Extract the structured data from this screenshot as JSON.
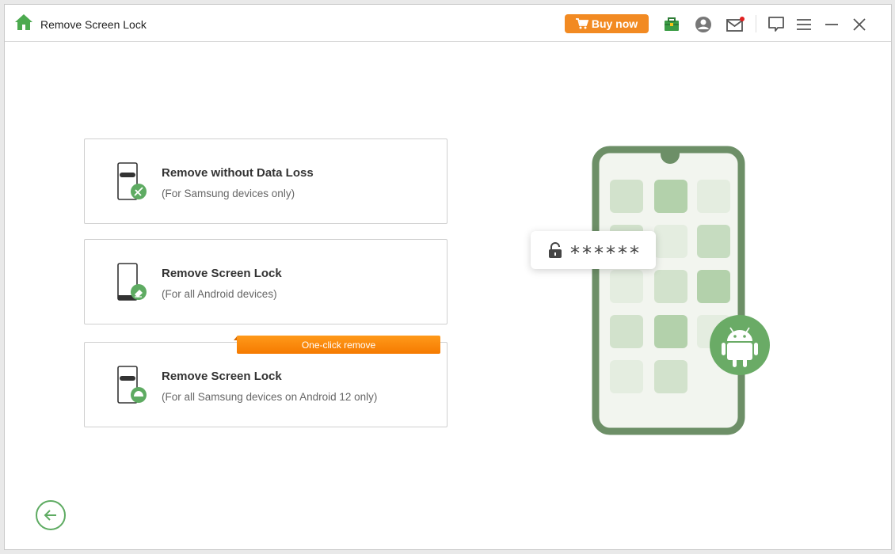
{
  "app": {
    "title": "Remove Screen Lock"
  },
  "toolbar": {
    "buy_label": "Buy now"
  },
  "options": [
    {
      "title": "Remove without Data Loss",
      "subtitle": "(For Samsung devices only)"
    },
    {
      "title": "Remove Screen Lock",
      "subtitle": "(For all Android devices)"
    },
    {
      "title": "Remove Screen Lock",
      "subtitle": "(For all Samsung devices on Android 12 only)",
      "badge": "One-click remove"
    }
  ],
  "illustration": {
    "password_mask": "******"
  },
  "colors": {
    "accent_green": "#5eab62",
    "buy_orange": "#f28a22",
    "phone_green": "#6d8f67"
  }
}
